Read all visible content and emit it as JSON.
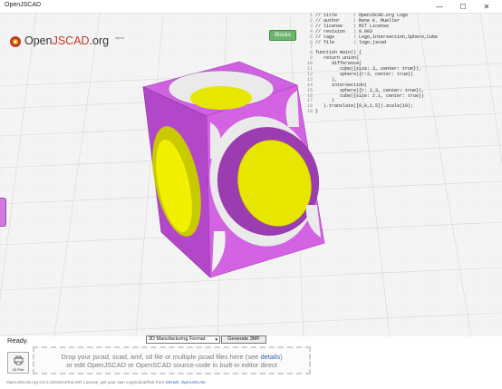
{
  "window": {
    "title": "OpenJSCAD",
    "minimize": "—",
    "maximize": "☐",
    "close": "✕"
  },
  "logo": {
    "prefix": "Open",
    "highlight": "JSCAD",
    "suffix": ".org",
    "badge": "alpha"
  },
  "toolbar": {
    "blocks_label": "Blocks"
  },
  "editor": {
    "lines": [
      {
        "n": "1",
        "text": "// title      : OpenJSCAD.org Logo"
      },
      {
        "n": "2",
        "text": "// author     : Rene K. Mueller"
      },
      {
        "n": "3",
        "text": "// license    : MIT License"
      },
      {
        "n": "4",
        "text": "// revision   : 0.003"
      },
      {
        "n": "5",
        "text": "// tags       : Logo,Intersection,Sphere,Cube"
      },
      {
        "n": "6",
        "text": "// file       : logo.jscad"
      },
      {
        "n": "7",
        "text": ""
      },
      {
        "n": "8",
        "text": "function main() {"
      },
      {
        "n": "9",
        "text": "   return union("
      },
      {
        "n": "10",
        "text": "      difference("
      },
      {
        "n": "11",
        "text": "         cube({size: 3, center: true}),"
      },
      {
        "n": "12",
        "text": "         sphere({r:2, center: true})"
      },
      {
        "n": "13",
        "text": "      ),"
      },
      {
        "n": "14",
        "text": "      intersection("
      },
      {
        "n": "15",
        "text": "         sphere({r: 1.3, center: true}),"
      },
      {
        "n": "16",
        "text": "         cube({size: 2.1, center: true})"
      },
      {
        "n": "17",
        "text": "      )"
      },
      {
        "n": "18",
        "text": "   ).translate([0,0,1.5]).scale(10);"
      },
      {
        "n": "19",
        "text": "}"
      }
    ]
  },
  "status": {
    "text": "Ready."
  },
  "export": {
    "format_selected": "3D Manufacturing Format",
    "generate_label": "Generate 3MF"
  },
  "print": {
    "label": "3D Print"
  },
  "dropzone": {
    "line1_before": "Drop your jscad, scad, amf, stl file or multiple jscad files here (see",
    "line1_link": "details",
    "line1_after": ")",
    "line2": "or edit OpenJSCAD or OpenSCAD source-code in built-in editor direct"
  },
  "footer": {
    "text": "OpenJSCAD.org 0.5.3 (2016/12/04) MIT License, get your own copy/clone/fork from",
    "link": "GitHub: OpenJSCAD"
  },
  "colors": {
    "cube": "#cc55e0",
    "sphere": "#e6e600",
    "accent": "#3e8e3e"
  }
}
